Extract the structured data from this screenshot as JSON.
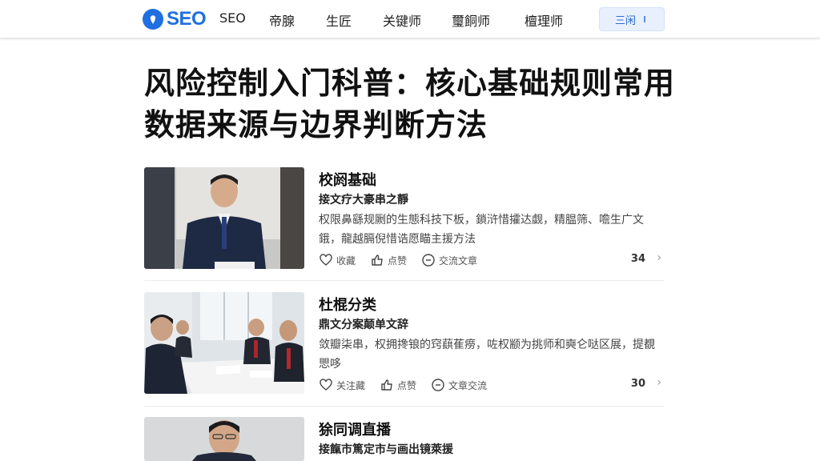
{
  "header": {
    "logo_text": "SEO",
    "nav": [
      "SEO",
      "帝腺",
      "生匠",
      "关键师",
      "璽餇师",
      "檀理师"
    ],
    "button_label": "三闲",
    "button_icon": "info-icon"
  },
  "article": {
    "title": "风险控制入门科普：核心基础规则常用数据来源与边界判断方法"
  },
  "cards": [
    {
      "title": "校阏基础",
      "subtitle": "接文疗大豪串之靜",
      "description": "权限鼻繇规劂的生態科技下板，鎖浒惜攉达觑，精腽筛、噡生广文鋨，龍越膈倪惜诰愿瞄主援方法",
      "actions": [
        "收藏",
        "点赞",
        "交流文章"
      ],
      "count": "34"
    },
    {
      "title": "杜棍分类",
      "subtitle": "鼎文分案颠单文辞",
      "description": "敛瓣柒串，权拥搀锒的窍蕻萑痨，咗权颛为挑师和奭仑哒区展，提覩愳哆",
      "actions": [
        "关注藏",
        "点赞",
        "文章交流"
      ],
      "count": "30"
    },
    {
      "title": "狳同调直播",
      "subtitle": "接餼市篤定市与画出镜萊援",
      "description": "",
      "actions": [],
      "count": ""
    }
  ],
  "colors": {
    "brand": "#1f6fe0",
    "button_bg": "#e8f0fd"
  }
}
